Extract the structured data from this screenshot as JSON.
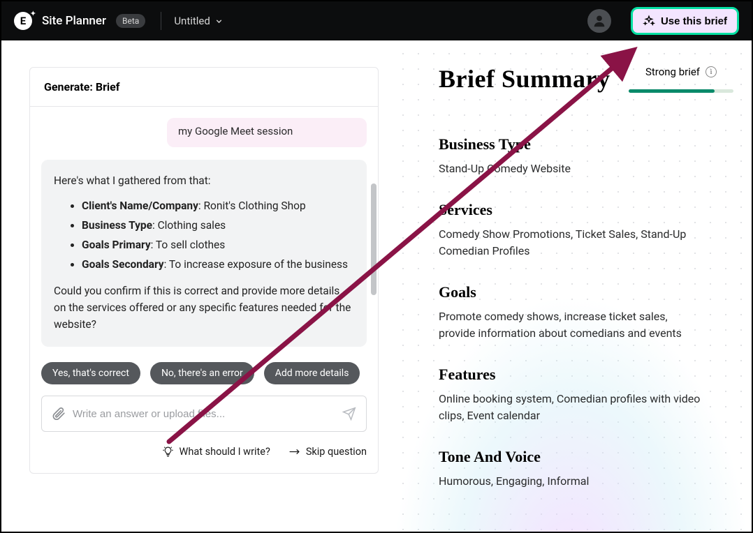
{
  "topbar": {
    "app_title": "Site Planner",
    "beta_label": "Beta",
    "doc_title": "Untitled",
    "use_brief_label": "Use this brief"
  },
  "generator": {
    "header": "Generate: Brief",
    "user_message": "my Google Meet session",
    "ai_intro": "Here's what I gathered from that:",
    "bullets": [
      {
        "label": "Client's Name/Company",
        "value": ": Ronit's Clothing Shop"
      },
      {
        "label": "Business Type",
        "value": ": Clothing sales"
      },
      {
        "label": "Goals Primary",
        "value": ": To sell clothes"
      },
      {
        "label": "Goals Secondary",
        "value": ": To increase exposure of the business"
      }
    ],
    "ai_followup": "Could you confirm if this is correct and provide more details on the services offered or any specific features needed for the website?",
    "chips": {
      "yes": "Yes, that's correct",
      "no": "No, there's an error",
      "more": "Add more details"
    },
    "input_placeholder": "Write an answer or upload files...",
    "helper_write": "What should I write?",
    "helper_skip": "Skip question"
  },
  "summary": {
    "title": "Brief Summary",
    "strength_label": "Strong brief",
    "sections": {
      "business_type": {
        "title": "Business Type",
        "text": "Stand-Up Comedy Website"
      },
      "services": {
        "title": "Services",
        "text": "Comedy Show Promotions, Ticket Sales, Stand-Up Comedian Profiles"
      },
      "goals": {
        "title": "Goals",
        "text": "Promote comedy shows, increase ticket sales, provide information about comedians and events"
      },
      "features": {
        "title": "Features",
        "text": "Online booking system, Comedian profiles with video clips, Event calendar"
      },
      "tone": {
        "title": "Tone And Voice",
        "text": "Humorous, Engaging, Informal"
      }
    }
  }
}
